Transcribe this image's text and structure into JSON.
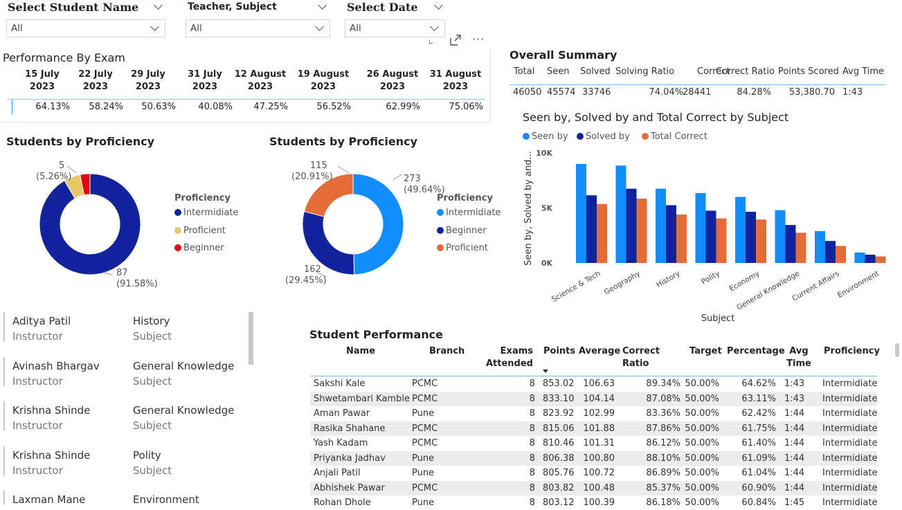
{
  "slicers": [
    {
      "title": "Select Student Name",
      "value": "All"
    },
    {
      "title": "Teacher, Subject",
      "value": "All"
    },
    {
      "title": "Select Date",
      "value": "All"
    }
  ],
  "header_icons": [
    "focus-mode-icon",
    "more-options-icon"
  ],
  "performance_by_exam": {
    "title": "Performance By Exam",
    "columns": [
      {
        "date": "15 July",
        "year": "2023",
        "value": "64.13%"
      },
      {
        "date": "22 July",
        "year": "2023",
        "value": "58.24%"
      },
      {
        "date": "29 July",
        "year": "2023",
        "value": "50.63%"
      },
      {
        "date": "31 July",
        "year": "2023",
        "value": "40.08%"
      },
      {
        "date": "12 August",
        "year": "2023",
        "value": "47.25%"
      },
      {
        "date": "19 August",
        "year": "2023",
        "value": "56.52%"
      },
      {
        "date": "26 August",
        "year": "2023",
        "value": "62.99%"
      },
      {
        "date": "31 August",
        "year": "2023",
        "value": "75.06%"
      }
    ]
  },
  "overall_summary": {
    "title": "Overall Summary",
    "headers": [
      "Total",
      "Seen",
      "Solved",
      "Solving Ratio",
      "Correct",
      "Correct Ratio",
      "Points Scored",
      "Avg Time"
    ],
    "values": [
      "46050",
      "45574",
      "33746",
      "74.04%",
      "28441",
      "84.28%",
      "53,380.70",
      "1:43"
    ]
  },
  "donut1": {
    "title": "Students by Proficiency",
    "legend_title": "Proficiency",
    "legend": [
      {
        "label": "Intermidiate",
        "color": "#12239E"
      },
      {
        "label": "Proficient",
        "color": "#E8C96A"
      },
      {
        "label": "Beginner",
        "color": "#E4060F"
      }
    ],
    "labels": {
      "top_count": "5",
      "top_pct": "(5.26%)",
      "bottom_count": "87",
      "bottom_pct": "(91.58%)"
    }
  },
  "donut2": {
    "title": "Students by Proficiency",
    "legend_title": "Proficiency",
    "legend": [
      {
        "label": "Intermidiate",
        "color": "#118DFF"
      },
      {
        "label": "Beginner",
        "color": "#12239E"
      },
      {
        "label": "Proficient",
        "color": "#E66C37"
      }
    ],
    "labels": {
      "a_count": "115",
      "a_pct": "(20.91%)",
      "b_count": "273",
      "b_pct": "(49.64%)",
      "c_count": "162",
      "c_pct": "(29.45%)"
    }
  },
  "chart_data": [
    {
      "type": "pie",
      "title": "Students by Proficiency",
      "categories": [
        "Intermidiate",
        "Proficient",
        "Beginner"
      ],
      "values": [
        87,
        5,
        3
      ],
      "colors": [
        "#12239E",
        "#E8C96A",
        "#E4060F"
      ]
    },
    {
      "type": "pie",
      "title": "Students by Proficiency",
      "categories": [
        "Intermidiate",
        "Beginner",
        "Proficient"
      ],
      "values": [
        273,
        162,
        115
      ],
      "colors": [
        "#118DFF",
        "#12239E",
        "#E66C37"
      ]
    },
    {
      "type": "bar",
      "title": "Seen by, Solved by and Total Correct by Subject",
      "xlabel": "Subject",
      "ylabel": "Seen by, Solved by and...",
      "ylim": [
        0,
        10000
      ],
      "yticks": [
        "0K",
        "5K",
        "10K"
      ],
      "categories": [
        "Science & Tech",
        "Geography",
        "History",
        "Polity",
        "Economy",
        "General Knowledge",
        "Current Affairs",
        "Environment"
      ],
      "series": [
        {
          "name": "Seen by",
          "color": "#118DFF",
          "values": [
            9000,
            8850,
            6750,
            6350,
            6000,
            4800,
            2900,
            950
          ]
        },
        {
          "name": "Solved by",
          "color": "#12239E",
          "values": [
            6150,
            6750,
            5250,
            4750,
            4650,
            3450,
            2000,
            750
          ]
        },
        {
          "name": "Total Correct",
          "color": "#E66C37",
          "values": [
            5350,
            5850,
            4400,
            4050,
            3950,
            2750,
            1550,
            600
          ]
        }
      ]
    }
  ],
  "instructors": [
    {
      "name": "Aditya Patil",
      "role": "Instructor",
      "subject": "History",
      "subject_label": "Subject"
    },
    {
      "name": "Avinash Bhargav",
      "role": "Instructor",
      "subject": "General Knowledge",
      "subject_label": "Subject"
    },
    {
      "name": "Krishna Shinde",
      "role": "Instructor",
      "subject": "General Knowledge",
      "subject_label": "Subject"
    },
    {
      "name": "Krishna Shinde",
      "role": "Instructor",
      "subject": "Polity",
      "subject_label": "Subject"
    },
    {
      "name": "Laxman Mane",
      "role": "",
      "subject": "Environment",
      "subject_label": ""
    }
  ],
  "student_performance": {
    "title": "Student Performance",
    "headers": [
      "Name",
      "Branch",
      "Exams Attended",
      "Points",
      "Average",
      "Correct Ratio",
      "Target",
      "Percentage",
      "Avg Time",
      "Proficiency"
    ],
    "rows": [
      [
        "Sakshi Kale",
        "PCMC",
        "8",
        "853.02",
        "106.63",
        "89.34%",
        "50.00%",
        "64.62%",
        "1:43",
        "Intermidiate"
      ],
      [
        "Shwetambari  Kamble",
        "PCMC",
        "8",
        "833.10",
        "104.14",
        "87.08%",
        "50.00%",
        "63.11%",
        "1:43",
        "Intermidiate"
      ],
      [
        "Aman Pawar",
        "Pune",
        "8",
        "823.92",
        "102.99",
        "83.36%",
        "50.00%",
        "62.42%",
        "1:44",
        "Intermidiate"
      ],
      [
        "Rasika Shahane",
        "PCMC",
        "8",
        "815.06",
        "101.88",
        "87.86%",
        "50.00%",
        "61.75%",
        "1:44",
        "Intermidiate"
      ],
      [
        "Yash Kadam",
        "PCMC",
        "8",
        "810.46",
        "101.31",
        "86.12%",
        "50.00%",
        "61.40%",
        "1:44",
        "Intermidiate"
      ],
      [
        "Priyanka Jadhav",
        "Pune",
        "8",
        "806.38",
        "100.80",
        "88.10%",
        "50.00%",
        "61.09%",
        "1:44",
        "Intermidiate"
      ],
      [
        "Anjali Patil",
        "Pune",
        "8",
        "805.76",
        "100.72",
        "86.89%",
        "50.00%",
        "61.04%",
        "1:44",
        "Intermidiate"
      ],
      [
        "Abhishek Pawar",
        "PCMC",
        "8",
        "803.82",
        "100.48",
        "85.37%",
        "50.00%",
        "60.90%",
        "1:44",
        "Intermidiate"
      ],
      [
        "Rohan Dhole",
        "Pune",
        "8",
        "803.12",
        "100.39",
        "86.18%",
        "50.00%",
        "60.84%",
        "1:45",
        "Intermidiate"
      ]
    ]
  }
}
